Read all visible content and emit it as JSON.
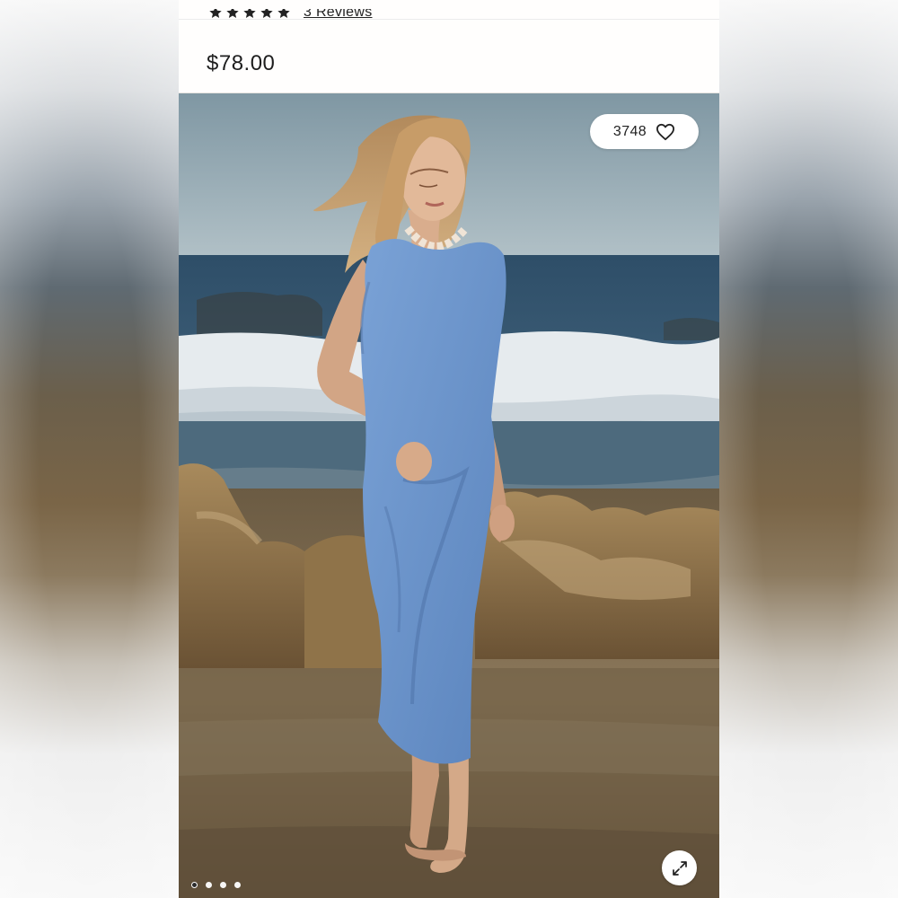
{
  "product": {
    "rating_stars": 5,
    "reviews_link": "3 Reviews",
    "price": "$78.00"
  },
  "gallery": {
    "likes_count": "3748",
    "heart_icon": "heart-outline-icon",
    "expand_icon": "expand-arrows-icon",
    "image_count": 4,
    "active_index": 0
  },
  "colors": {
    "text": "#1e1e1e",
    "dress": "#6f97cf",
    "background": "#ffffff"
  }
}
